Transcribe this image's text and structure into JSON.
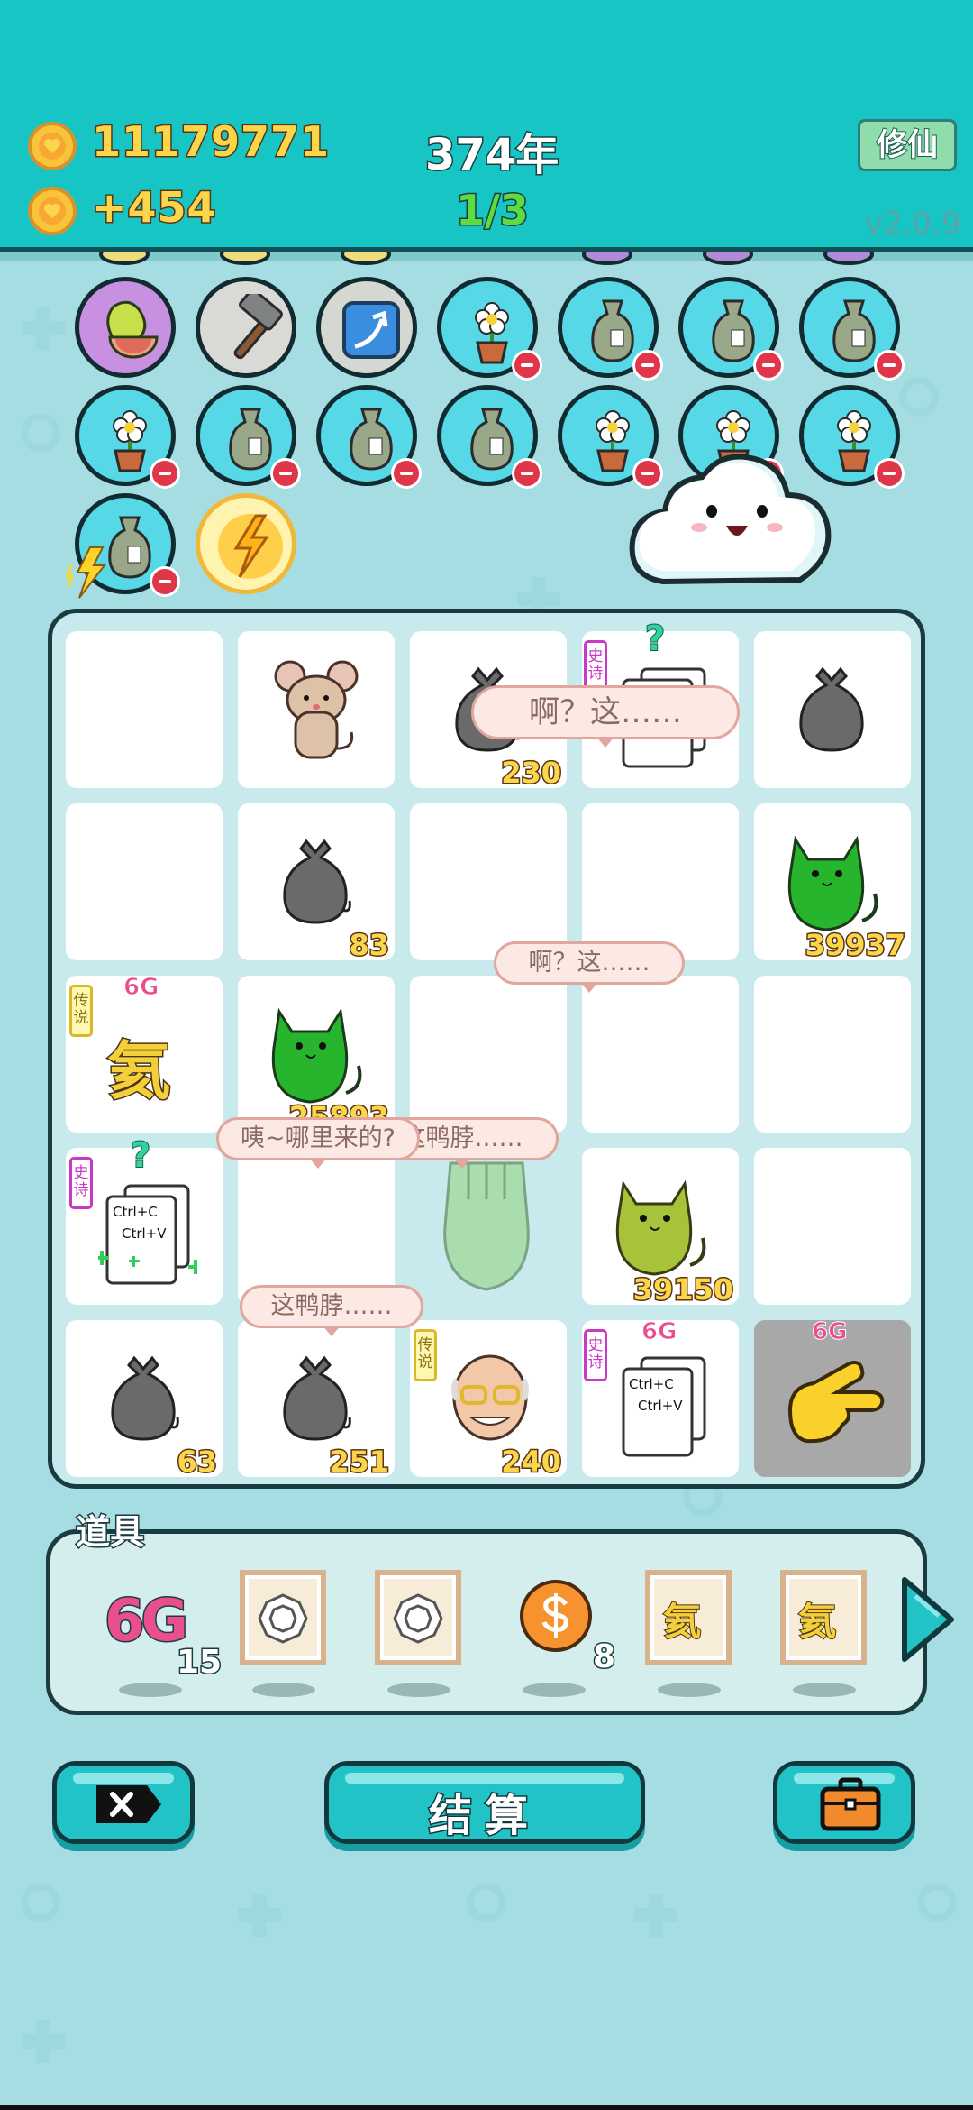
{
  "header": {
    "coins": "11179771",
    "income": "+454",
    "year": "374年",
    "stage": "1/3",
    "cultivate_button": "修仙",
    "version": "v2.0.9",
    "icon": "heart-coin-icon"
  },
  "skills": {
    "row1": [
      "grapefruit",
      "hammer",
      "upgrade-arrow",
      "flower-pot",
      "trash-bag",
      "trash-bag",
      "trash-bag"
    ],
    "row2": [
      "flower-pot",
      "trash-bag",
      "trash-bag",
      "trash-bag",
      "flower-pot",
      "flower-pot",
      "flower-pot"
    ],
    "row3": [
      "trash-bag-charged",
      "lightning-orb"
    ]
  },
  "board": {
    "cells": {
      "r0c2": "230",
      "r1c1": "83",
      "r1c4": "39937",
      "r2c0_element": "氦",
      "r2c1": "25893",
      "r3c3": "39150",
      "r4c0": "63",
      "r4c1": "251",
      "r4c2": "240"
    },
    "tags": {
      "epic": "史诗",
      "legend": "传说"
    },
    "badge_6g": "6G",
    "qmark": "?",
    "ctrl_c": "Ctrl+C",
    "ctrl_v": "Ctrl+V",
    "bubbles": {
      "b1": "啊？这……",
      "b2": "啊？这……",
      "b3": "咦~哪里来的?",
      "b4": "这鸭脖……",
      "b5": "这鸭脖……"
    }
  },
  "items": {
    "label": "道具",
    "sixg_text": "6G",
    "sixg_count": "15",
    "coin_count": "8",
    "helium": "氦"
  },
  "buttons": {
    "settle": "结算",
    "close_icon": "close-icon",
    "bag_icon": "briefcase-icon"
  },
  "colors": {
    "header": "#17c6c4",
    "background": "#a6dde3",
    "number_gold": "#fbd64a"
  }
}
